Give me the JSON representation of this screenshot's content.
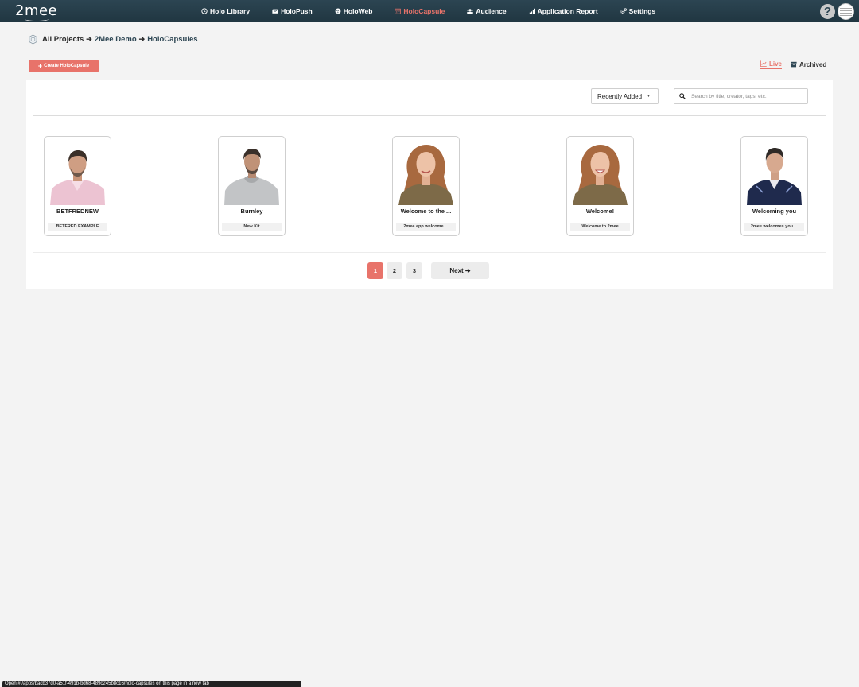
{
  "app": {
    "logo_text": "2mee"
  },
  "nav": {
    "items": [
      {
        "label": "Holo Library",
        "icon": "clock-icon"
      },
      {
        "label": "HoloPush",
        "icon": "envelope-icon"
      },
      {
        "label": "HoloWeb",
        "icon": "globe-icon"
      },
      {
        "label": "HoloCapsule",
        "icon": "calendar-icon",
        "active": true
      },
      {
        "label": "Audience",
        "icon": "users-icon"
      },
      {
        "label": "Application Report",
        "icon": "bar-chart-icon"
      },
      {
        "label": "Settings",
        "icon": "gears-icon"
      }
    ],
    "help_label": "?"
  },
  "breadcrumb": {
    "items": [
      "All Projects",
      "2Mee Demo",
      "HoloCapsules"
    ],
    "separator": "➔"
  },
  "toolbar": {
    "create_label": "Create HoloCapsule",
    "create_icon": "+",
    "view_live": "Live",
    "view_archived": "Archived",
    "sort_selected": "Recently Added",
    "search_placeholder": "Search by title, creator, tags, etc."
  },
  "capsules": [
    {
      "title": "BETFREDNEW",
      "subtitle": "BETFRED EXAMPLE"
    },
    {
      "title": "Burnley",
      "subtitle": "New Kit"
    },
    {
      "title": "Welcome to the ...",
      "subtitle": "2mee app welcome ..."
    },
    {
      "title": "Welcome!",
      "subtitle": "Welcome to 2mee"
    },
    {
      "title": "Welcoming you",
      "subtitle": "2mee welcomes you ..."
    }
  ],
  "pagination": {
    "pages": [
      "1",
      "2",
      "3"
    ],
    "current": "1",
    "next_label": "Next ➔"
  },
  "status_bar": {
    "text": "Open #!/apps/bacb37d0-a51f-491b-bd68-489c245b8c16/holo-capsules on this page in a new tab"
  },
  "colors": {
    "accent": "#e8736a",
    "nav_bg": "#2c4552",
    "page_bg": "#f3f3f3"
  }
}
